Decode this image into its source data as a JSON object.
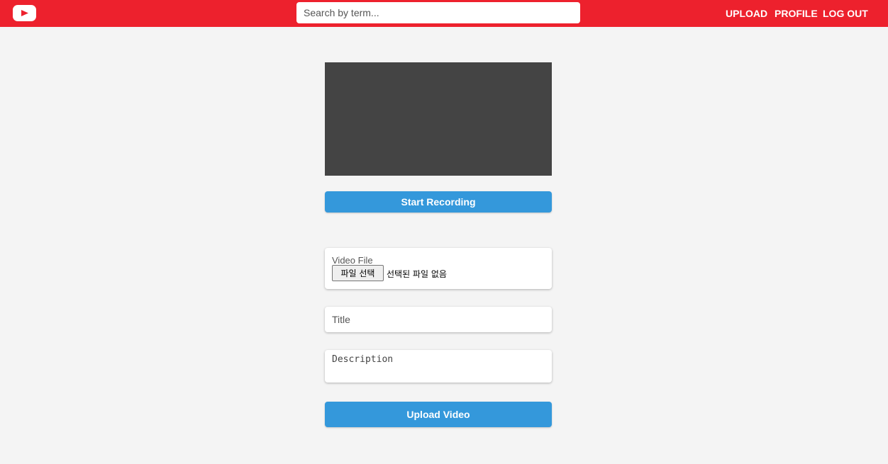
{
  "header": {
    "logo_icon": "play-icon",
    "search": {
      "placeholder": "Search by term...",
      "value": ""
    },
    "nav": {
      "upload": "UPLOAD",
      "profile": "PROFILE",
      "logout": "LOG OUT"
    }
  },
  "recorder": {
    "start_label": "Start Recording"
  },
  "form": {
    "video_file": {
      "label": "Video File",
      "button_label": "파일 선택",
      "status": "선택된 파일 없음"
    },
    "title": {
      "placeholder": "Title",
      "value": ""
    },
    "description": {
      "placeholder": "Description",
      "value": ""
    },
    "submit_label": "Upload Video"
  },
  "colors": {
    "header_bg": "#ed212d",
    "accent": "#3498db",
    "preview_bg": "#444444",
    "page_bg": "#f4f4f4"
  }
}
